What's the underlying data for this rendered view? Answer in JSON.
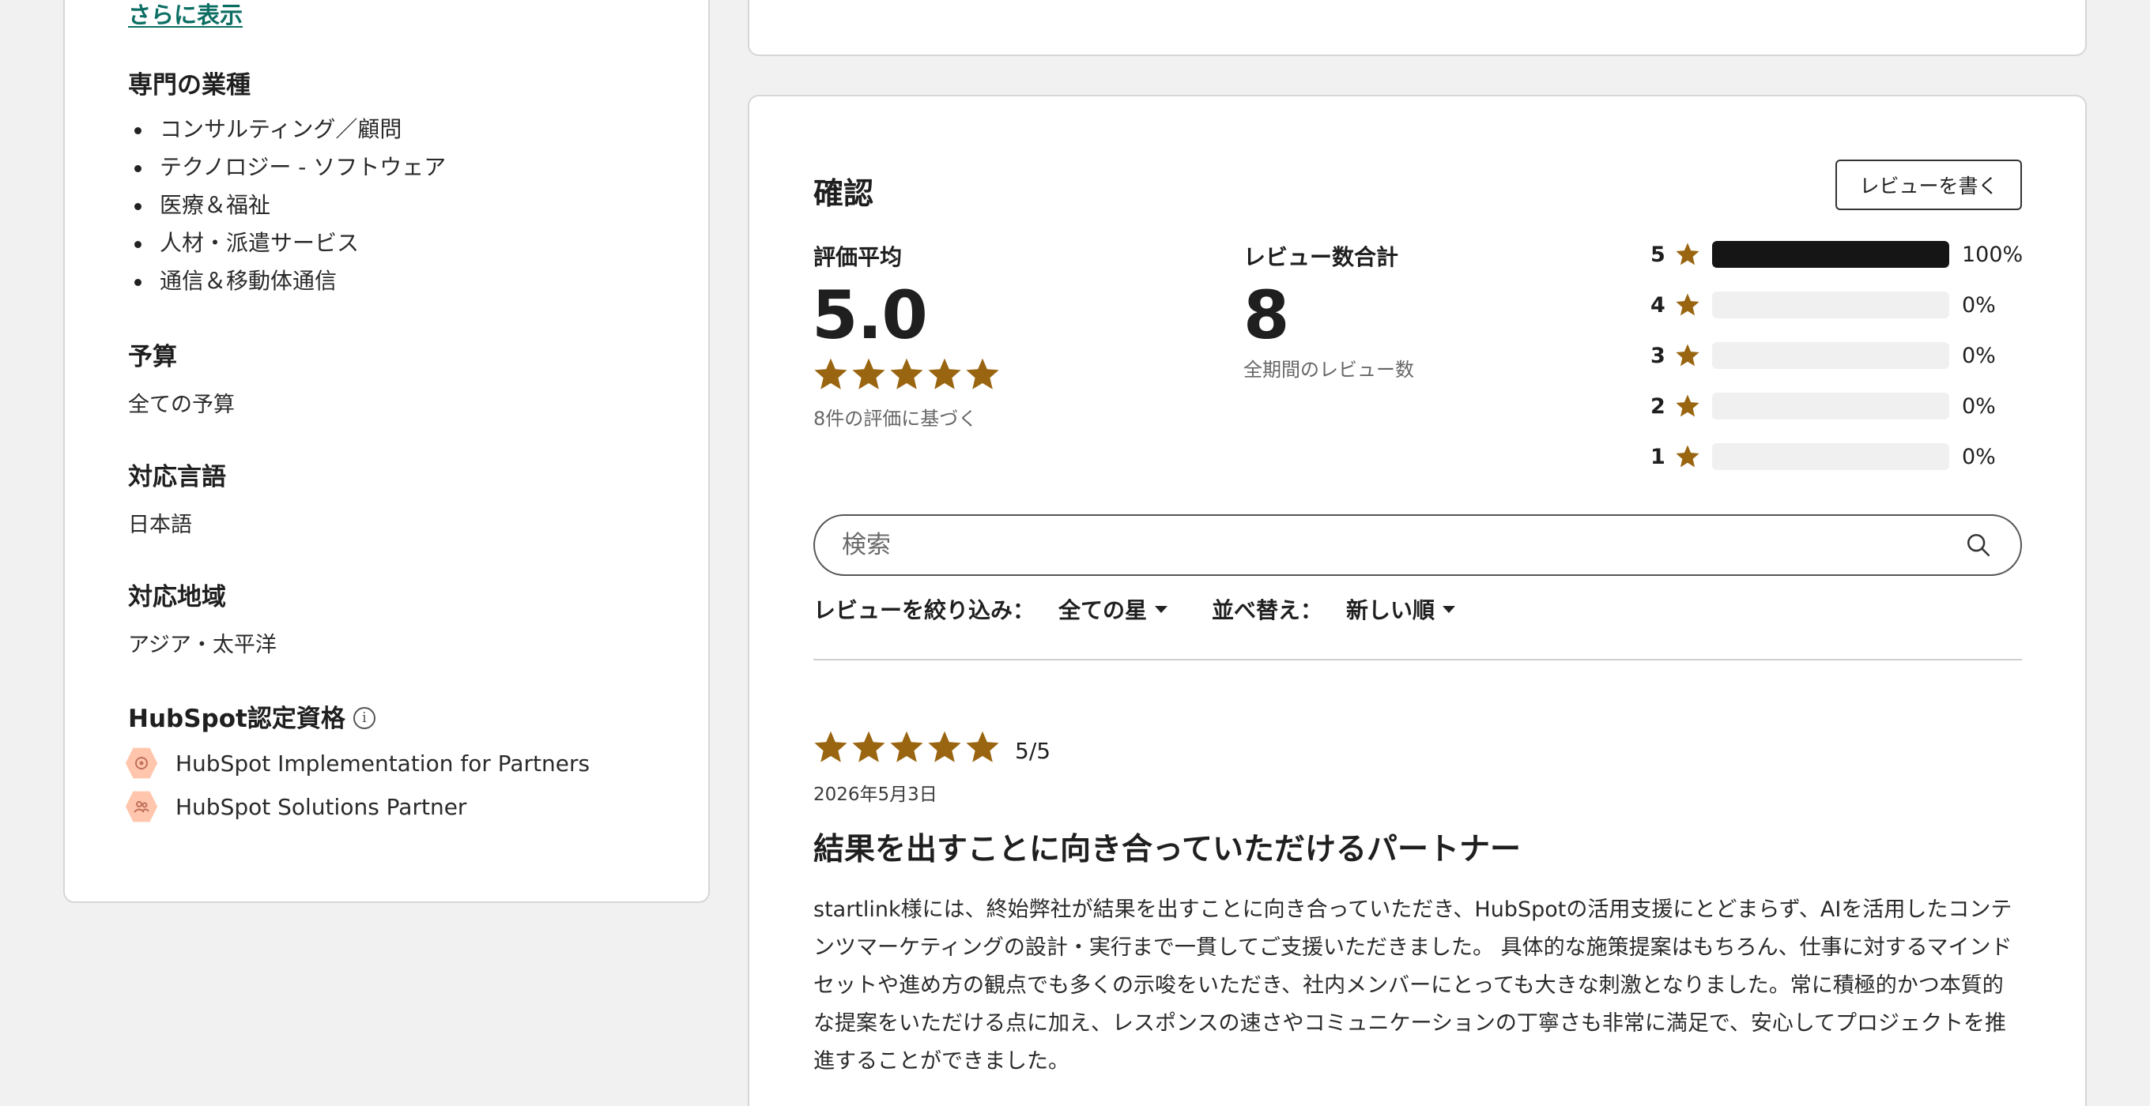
{
  "sidebar": {
    "show_more": "さらに表示",
    "industries_title": "専門の業種",
    "industries": [
      "コンサルティング／顧問",
      "テクノロジー - ソフトウェア",
      "医療＆福祉",
      "人材・派遣サービス",
      "通信＆移動体通信"
    ],
    "budget_title": "予算",
    "budget_value": "全ての予算",
    "language_title": "対応言語",
    "language_value": "日本語",
    "region_title": "対応地域",
    "region_value": "アジア・太平洋",
    "certs_title": "HubSpot認定資格",
    "certs": [
      "HubSpot Implementation for Partners",
      "HubSpot Solutions Partner"
    ]
  },
  "reviews": {
    "title": "確認",
    "write_button": "レビューを書く",
    "avg_label": "評価平均",
    "avg_value": "5.0",
    "avg_rating": 5,
    "avg_sub": "8件の評価に基づく",
    "total_label": "レビュー数合計",
    "total_value": "8",
    "total_sub": "全期間のレビュー数",
    "distribution": [
      {
        "stars": "5",
        "fraction": 1.0,
        "pct": "100%"
      },
      {
        "stars": "4",
        "fraction": 0.0,
        "pct": "0%"
      },
      {
        "stars": "3",
        "fraction": 0.0,
        "pct": "0%"
      },
      {
        "stars": "2",
        "fraction": 0.0,
        "pct": "0%"
      },
      {
        "stars": "1",
        "fraction": 0.0,
        "pct": "0%"
      }
    ],
    "search_placeholder": "検索",
    "filter_label": "レビューを絞り込み：",
    "filter_value": "全ての星",
    "sort_label": "並べ替え：",
    "sort_value": "新しい順"
  },
  "review_item": {
    "rating": 5,
    "score": "5/5",
    "date": "2026年5月3日",
    "headline": "結果を出すことに向き合っていただけるパートナー",
    "body": "startlink様には、終始弊社が結果を出すことに向き合っていただき、HubSpotの活用支援にとどまらず、AIを活用したコンテンツマーケティングの設計・実行まで一貫してご支援いただきました。 具体的な施策提案はもちろん、仕事に対するマインドセットや進め方の観点でも多くの示唆をいただき、社内メンバーにとっても大きな刺激となりました。常に積極的かつ本質的な提案をいただける点に加え、レスポンスの速さやコミュニケーションの丁寧さも非常に満足で、安心してプロジェクトを推進することができました。"
  },
  "colors": {
    "star": "#9a6510",
    "link": "#0b6e63",
    "bar_fill": "#151515",
    "badge": "#ffc6ad"
  },
  "icons": {
    "info": "info-circle-icon",
    "search": "search-icon",
    "star": "star-icon",
    "cert": "certification-badge-icon",
    "caret": "caret-down-icon"
  }
}
